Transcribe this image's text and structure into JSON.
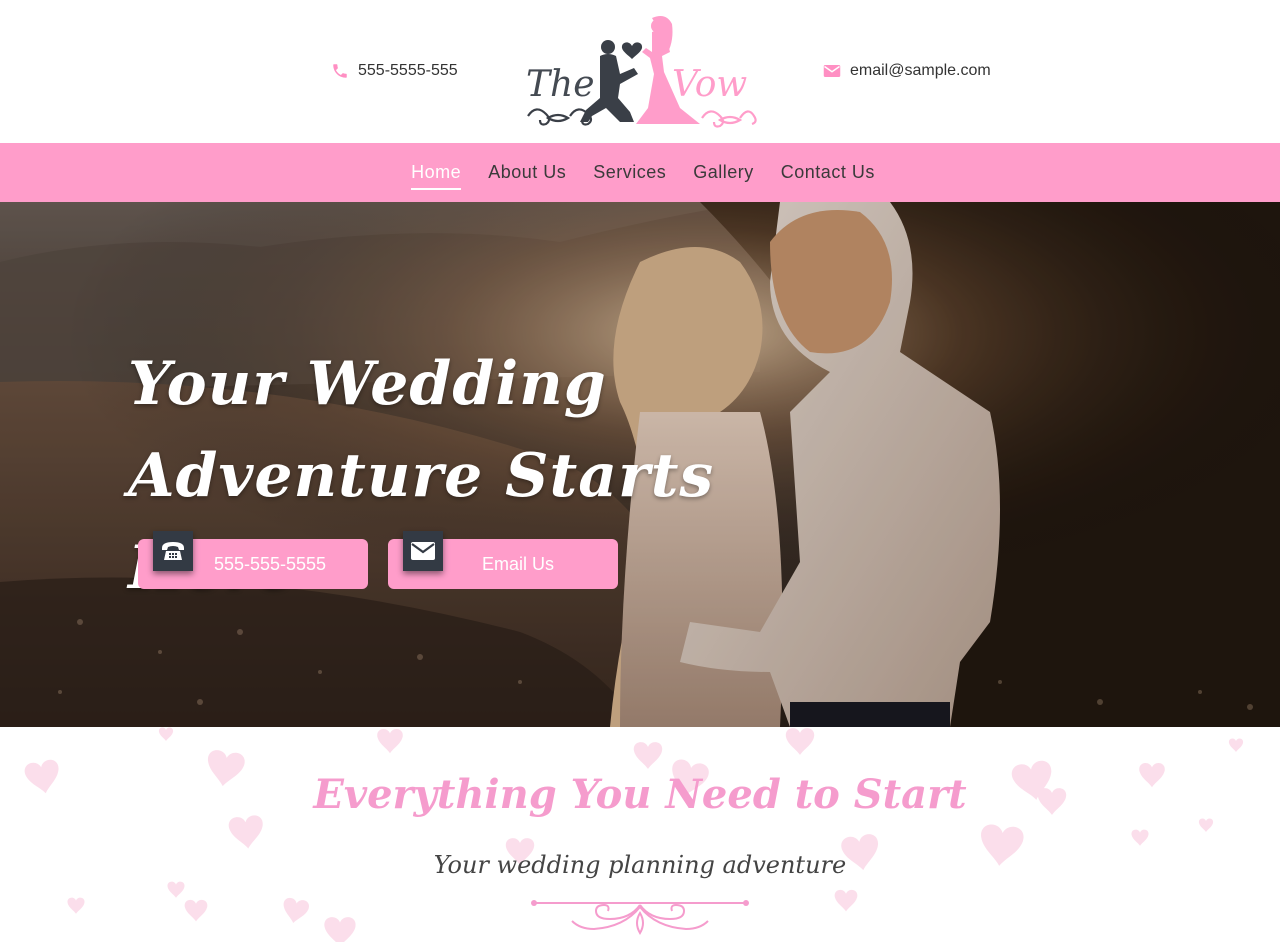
{
  "header": {
    "phone": "555-5555-555",
    "email": "email@sample.com",
    "logo": {
      "word_left": "The",
      "word_right": "Vow",
      "icon": "couple-proposal-logo"
    }
  },
  "nav": {
    "items": [
      {
        "label": "Home",
        "active": true
      },
      {
        "label": "About Us",
        "active": false
      },
      {
        "label": "Services",
        "active": false
      },
      {
        "label": "Gallery",
        "active": false
      },
      {
        "label": "Contact Us",
        "active": false
      }
    ]
  },
  "hero": {
    "title_line1": "Your Wedding",
    "title_line2": "Adventure Starts Here",
    "phone_button": {
      "label": "555-555-5555",
      "icon": "telephone-icon"
    },
    "email_button": {
      "label": "Email Us",
      "icon": "envelope-icon"
    }
  },
  "intro": {
    "title": "Everything You Need to Start",
    "subtitle": "Your wedding planning adventure"
  },
  "colors": {
    "accent_pink": "#ff9dca",
    "title_pink": "#f59ccd",
    "dark_badge": "#333a44",
    "text_dark": "#333333"
  }
}
